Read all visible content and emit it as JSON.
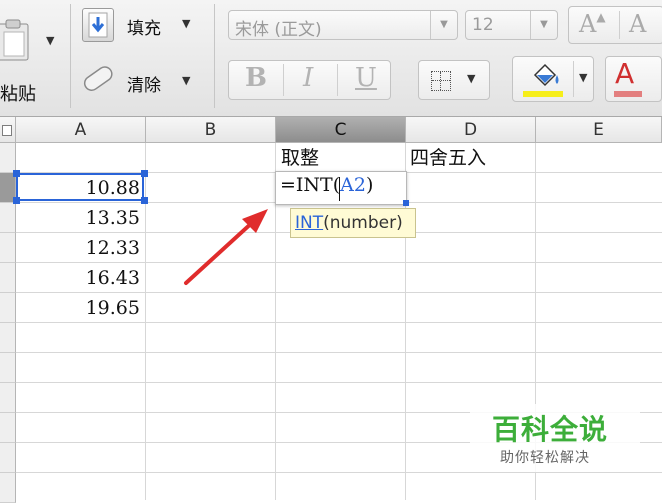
{
  "ribbon": {
    "paste_label": "粘贴",
    "fill_label": "填充",
    "clear_label": "清除",
    "font_name": "宋体 (正文)",
    "font_size": "12",
    "grow_font_symbol": "A",
    "shrink_font_symbol": "A",
    "bold": "B",
    "italic": "I",
    "underline": "U",
    "font_color_symbol": "A",
    "fill_color_hex": "#f6ee1a",
    "font_color_hex": "#e37f7f"
  },
  "grid": {
    "columns": [
      "A",
      "B",
      "C",
      "D",
      "E"
    ],
    "selected_column": "C",
    "selected_row": 2,
    "headers_row": {
      "C": "取整",
      "D": "四舍五入"
    },
    "column_a_values": [
      "10.88",
      "13.35",
      "12.33",
      "16.43",
      "19.65"
    ]
  },
  "editor": {
    "prefix": "=INT(",
    "ref": "A2",
    "suffix": ")",
    "tooltip_fn": "INT",
    "tooltip_args": "(number)"
  },
  "watermark": {
    "title": "百科全说",
    "subtitle": "助你轻松解决"
  }
}
